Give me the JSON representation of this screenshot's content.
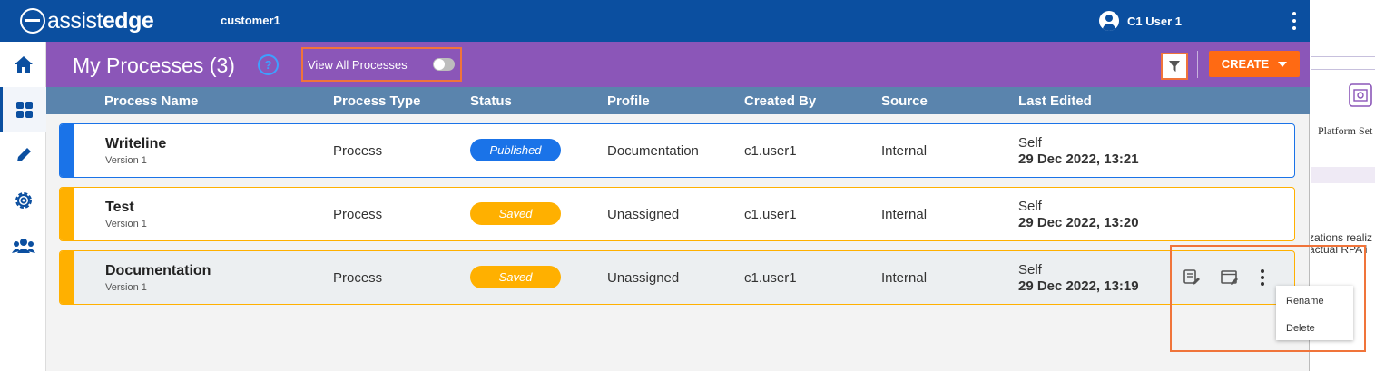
{
  "brand": {
    "logo_light": "assist",
    "logo_bold": "edge"
  },
  "topbar": {
    "customer": "customer1",
    "user_name": "C1 User 1"
  },
  "header": {
    "title": "My Processes (3)",
    "help_glyph": "?",
    "toggle_label": "View All Processes",
    "toggle_on": false,
    "create_label": "CREATE"
  },
  "columns": [
    "Process Name",
    "Process Type",
    "Status",
    "Profile",
    "Created By",
    "Source",
    "Last Edited"
  ],
  "processes": [
    {
      "name": "Writeline",
      "version": "Version 1",
      "type": "Process",
      "status": "Published",
      "profile": "Documentation",
      "created_by": "c1.user1",
      "source": "Internal",
      "edited_by": "Self",
      "edited_at": "29 Dec 2022, 13:21"
    },
    {
      "name": "Test",
      "version": "Version 1",
      "type": "Process",
      "status": "Saved",
      "profile": "Unassigned",
      "created_by": "c1.user1",
      "source": "Internal",
      "edited_by": "Self",
      "edited_at": "29 Dec 2022, 13:20"
    },
    {
      "name": "Documentation",
      "version": "Version 1",
      "type": "Process",
      "status": "Saved",
      "profile": "Unassigned",
      "created_by": "c1.user1",
      "source": "Internal",
      "edited_by": "Self",
      "edited_at": "29 Dec 2022, 13:19"
    }
  ],
  "context_menu": {
    "rename": "Rename",
    "delete": "Delete"
  },
  "background_page": {
    "tile_label": "Platform Set",
    "text_line1": "zations realiz",
    "text_line2": "actual RPA i"
  },
  "colors": {
    "topbar": "#0b4fa0",
    "header": "#8b56b8",
    "table_header": "#5a84ad",
    "published": "#1a73e8",
    "saved": "#ffb000",
    "accent": "#ff6a13",
    "highlight": "#f0743a"
  },
  "icons": {
    "nav": [
      "home-icon",
      "dashboard-icon",
      "pencil-icon",
      "gear-icon",
      "users-icon"
    ],
    "row_actions": [
      "edit-process-icon",
      "edit-window-icon",
      "more-icon"
    ]
  }
}
